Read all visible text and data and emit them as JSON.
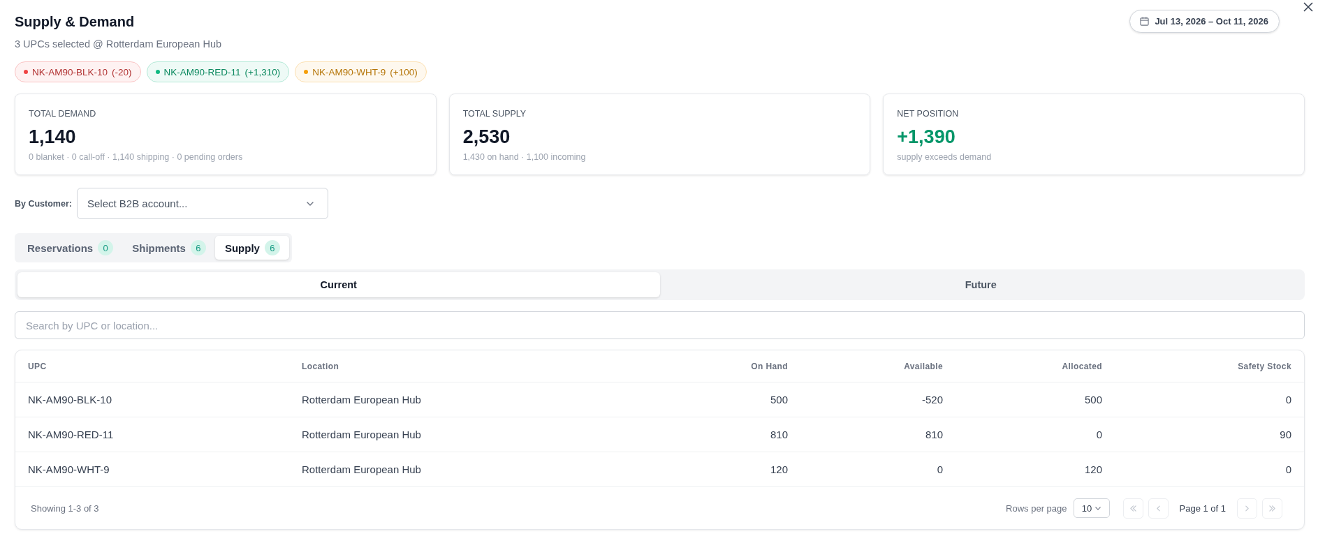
{
  "dialog": {
    "title": "Supply & Demand",
    "subtitle": "3 UPCs selected @ Rotterdam European Hub",
    "date_range": "Jul 13, 2026 – Oct 11, 2026"
  },
  "upcs": [
    {
      "code": "NK-AM90-BLK-10",
      "delta": "(-20)",
      "color": "#ef4444"
    },
    {
      "code": "NK-AM90-RED-11",
      "delta": "(+1,310)",
      "color": "#10b981"
    },
    {
      "code": "NK-AM90-WHT-9",
      "delta": "(+100)",
      "color": "#f59e0b"
    }
  ],
  "stats": [
    {
      "label": "TOTAL DEMAND",
      "value": "1,140",
      "detail": "0 blanket · 0 call-off · 1,140 shipping · 0 pending orders",
      "kind": "neutral"
    },
    {
      "label": "TOTAL SUPPLY",
      "value": "2,530",
      "detail": "1,430 on hand · 1,100 incoming",
      "kind": "neutral"
    },
    {
      "label": "NET POSITION",
      "value": "+1,390",
      "detail": "supply exceeds demand",
      "kind": "positive"
    }
  ],
  "customer_filter": {
    "label": "By Customer:",
    "placeholder": "Select B2B account..."
  },
  "tabs": [
    {
      "label": "Reservations",
      "count": "0",
      "selected": false
    },
    {
      "label": "Shipments",
      "count": "6",
      "selected": false
    },
    {
      "label": "Supply",
      "count": "6",
      "selected": true
    }
  ],
  "segments": [
    {
      "label": "Current",
      "selected": true
    },
    {
      "label": "Future",
      "selected": false
    }
  ],
  "search": {
    "placeholder": "Search by UPC or location..."
  },
  "table": {
    "columns": [
      "UPC",
      "Location",
      "On Hand",
      "Available",
      "Allocated",
      "Safety Stock"
    ],
    "rows": [
      [
        "NK-AM90-BLK-10",
        "Rotterdam European Hub",
        "500",
        "-520",
        "500",
        "0"
      ],
      [
        "NK-AM90-RED-11",
        "Rotterdam European Hub",
        "810",
        "810",
        "0",
        "90"
      ],
      [
        "NK-AM90-WHT-9",
        "Rotterdam European Hub",
        "120",
        "0",
        "120",
        "0"
      ]
    ]
  },
  "pagination": {
    "summary": "Showing 1-3 of 3",
    "rows_per_page_label": "Rows per page",
    "rows_per_page": "10",
    "page": "Page 1 of 1",
    "buttons": [
      {
        "kind": "first",
        "disabled": true
      },
      {
        "kind": "prev",
        "disabled": true
      },
      {
        "kind": "next",
        "disabled": true
      },
      {
        "kind": "last",
        "disabled": true
      }
    ]
  }
}
